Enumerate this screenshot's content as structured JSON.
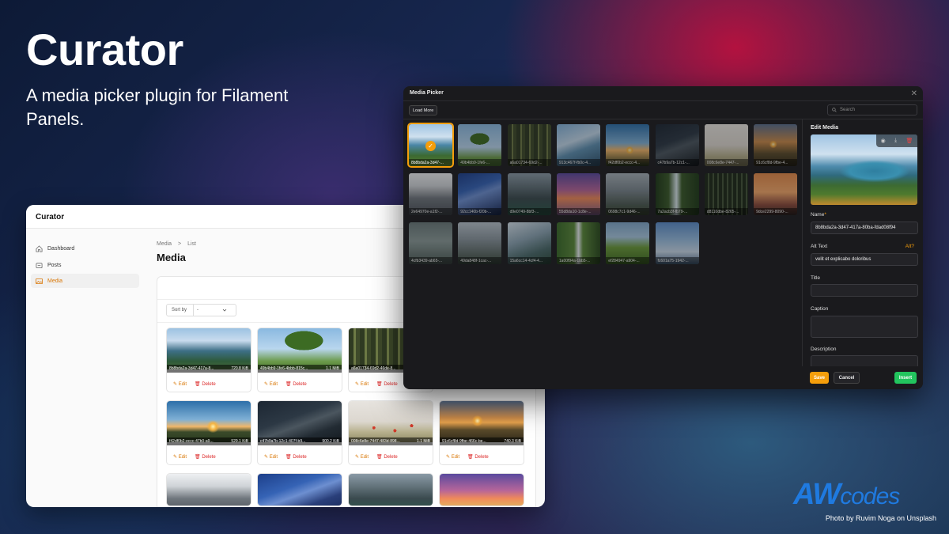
{
  "hero": {
    "title": "Curator",
    "subtitle": "A media picker plugin for Filament Panels."
  },
  "brand": {
    "logo_main": "AW",
    "logo_sub": "codes"
  },
  "credit": "Photo by Ruvim Noga on Unsplash",
  "admin": {
    "app_title": "Curator",
    "nav": [
      {
        "label": "Dashboard",
        "icon": "home-icon",
        "active": false
      },
      {
        "label": "Posts",
        "icon": "document-icon",
        "active": false
      },
      {
        "label": "Media",
        "icon": "photo-icon",
        "active": true
      }
    ],
    "breadcrumb": {
      "parent": "Media",
      "sep": ">",
      "current": "List"
    },
    "page_title": "Media",
    "sort": {
      "label": "Sort by",
      "value": "-"
    },
    "actions": {
      "edit": "Edit",
      "delete": "Delete"
    },
    "cards": [
      {
        "name": "8b8bda2a-3d47-417a-8...",
        "size": "720.8 KiB"
      },
      {
        "name": "49b4bb9-1fe6-4bbb-815c...",
        "size": "1.1 MiB"
      },
      {
        "name": "a6a01734-69d2-46de-8...",
        "size": ""
      },
      {
        "name": "f42df0b2-eccc-47b0-a9...",
        "size": "529.1 KiB"
      },
      {
        "name": "c47b9a7b-12c1-407f-b9...",
        "size": "900.2 KiB"
      },
      {
        "name": "008c6e8e-7447-483d-898...",
        "size": "1.1 MiB"
      },
      {
        "name": "91c6cf8d-9fbe-466c-be...",
        "size": "740.3 KiB"
      }
    ]
  },
  "picker": {
    "title": "Media Picker",
    "close": "✕",
    "load_more": "Load More",
    "search_placeholder": "Search",
    "thumbs": [
      "8b8bda2a-3d47-...",
      "49b4bb9-1fe6-...",
      "a6a01734-69d2-...",
      "913c467f-fb0c-4...",
      "f42df0b2-eccc-4...",
      "c47b9a7b-12c1-...",
      "008c6e8e-7447-...",
      "91c6cf8d-9fbe-4...",
      "2e64970e-a1f2-...",
      "92cc140b-f20b-...",
      "d9e0749-8bf3-...",
      "55d8da10-1c8e-...",
      "0698c7c1-9d46-...",
      "7a2acb3f-fb79-...",
      "d8110dbe-8265-...",
      "9dce2299-8090-...",
      "4cfb3439-ab65-...",
      "49da848f-1cac-...",
      "15a6cc14-4cf4-4...",
      "1a00f94a-1bb5-...",
      "ef284947-a904-...",
      "fc601a75-1942-..."
    ],
    "selected_index": 0,
    "edit": {
      "heading": "Edit Media",
      "name_label": "Name",
      "required_mark": "*",
      "name_value": "8b8bda2a-3d47-417a-80ba-fdad08f94",
      "alt_label": "Alt Text",
      "alt_link": "Alt?",
      "alt_value": "velit et explicabo doloribus",
      "title_label": "Title",
      "caption_label": "Caption",
      "description_label": "Description"
    },
    "buttons": {
      "save": "Save",
      "cancel": "Cancel",
      "insert": "Insert"
    }
  },
  "colors": {
    "accent": "#f59e0b",
    "danger": "#dc2626",
    "success": "#22c55e",
    "brand_blue": "#1f7ae0"
  }
}
